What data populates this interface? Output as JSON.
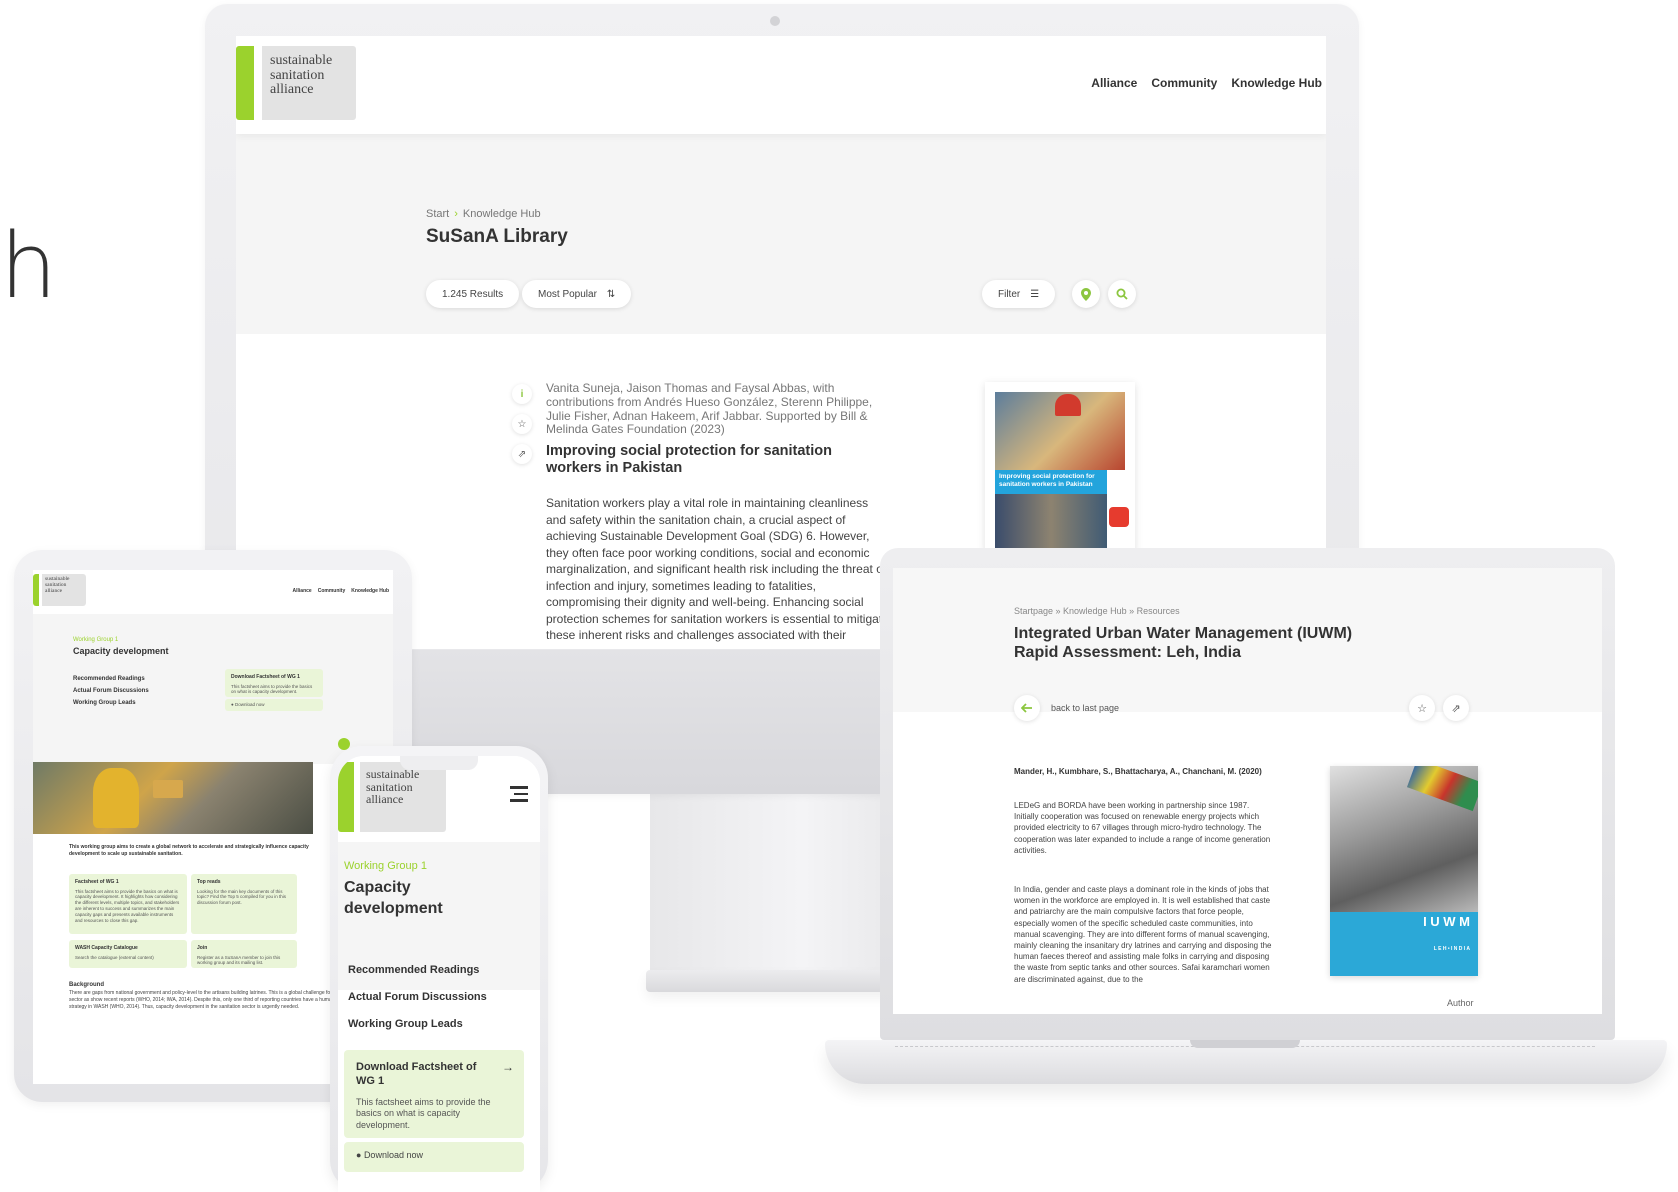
{
  "edge_letter": "h",
  "brand": {
    "logo_lines": [
      "sustainable",
      "sanitation",
      "alliance"
    ],
    "accent": "#9bd22d",
    "light_green": "#eaf5d8"
  },
  "nav": {
    "alliance": "Alliance",
    "community": "Community",
    "knowledge_hub": "Knowledge Hub"
  },
  "monitor": {
    "breadcrumb": [
      "Start",
      "Knowledge Hub"
    ],
    "title": "SuSanA Library",
    "results": "1.245 Results",
    "sort": "Most Popular",
    "filter": "Filter",
    "item": {
      "authors": "Vanita Suneja, Jaison Thomas and Faysal Abbas, with contributions from Andrés Hueso González, Sterenn Philippe, Julie Fisher, Adnan Hakeem, Arif Jabbar. Supported by Bill & Melinda Gates Foundation (2023)",
      "title": "Improving social protection for sanitation workers in Pakistan",
      "abstract": "Sanitation workers play a vital role in maintaining cleanliness and safety within the sanitation chain, a crucial aspect of achieving Sustainable Development Goal (SDG) 6. However, they often face poor working conditions, social and economic marginalization, and significant health risk including the threat of infection and injury, sometimes leading to fatalities, compromising their dignity and well-being. Enhancing social protection schemes for sanitation workers is essential to mitigate these inherent risks and challenges associated with their profession. WaterAid",
      "cover_caption": "Improving social protection for sanitation workers in Pakistan"
    }
  },
  "tablet": {
    "eyebrow": "Working Group 1",
    "title": "Capacity development",
    "links": [
      "Recommended Readings",
      "Actual Forum Discussions",
      "Working Group Leads"
    ],
    "download_card": {
      "title": "Download Factsheet of WG 1",
      "text": "This factsheet aims to provide the basics on what is capacity development.",
      "button": "Download now"
    },
    "intro": "This working group aims to create a global network to accelerate and strategically influence capacity development to scale up sustainable sanitation.",
    "cards": [
      {
        "title": "Factsheet of WG 1",
        "text": "This factsheet aims to provide the basics on what is capacity development. It highlights how considering the different levels, multiple topics, and stakeholders are inherent to success and summarizes the main capacity gaps and presents available instruments and resources to close this gap."
      },
      {
        "title": "Top reads",
        "text": "Looking for the main key documents of this topic? Find the Top 5 compiled for you in this discussion forum post."
      },
      {
        "title": "WASH Capacity Catalogue",
        "text": "Search the catalogue (external content)"
      },
      {
        "title": "Join",
        "text": "Register as a SuSanA member to join this working group and its mailing list."
      }
    ],
    "background_title": "Background",
    "background_text": "There are gaps from national government and policy-level to the artisans building latrines. This is a global challenge for the WASH sector as show recent reports (WHO, 2014; IWA, 2014). Despite this, only one third of reporting countries have a human resources strategy in WASH (WHO, 2014). Thus, capacity development in the sanitation sector is urgently needed."
  },
  "phone": {
    "eyebrow": "Working Group 1",
    "title": "Capacity development",
    "links": [
      "Recommended Readings",
      "Actual Forum Discussions",
      "Working Group Leads"
    ],
    "download_title": "Download Factsheet of WG 1",
    "download_text": "This factsheet aims to provide the basics on what is capacity development.",
    "download_button": "Download now"
  },
  "laptop": {
    "breadcrumb": "Startpage » Knowledge Hub » Resources",
    "title": "Integrated Urban Water Management (IUWM) Rapid Assessment: Leh, India",
    "back": "back to last page",
    "authors": "Mander, H., Kumbhare, S., Bhattacharya, A., Chanchani, M. (2020)",
    "para1": "LEDeG and BORDA have been working in partnership since 1987. Initially cooperation was focused on renewable energy projects which provided electricity to 67 villages through micro-hydro technology. The cooperation was later expanded to include a range of income generation activities.",
    "para2": "In India, gender and caste plays a dominant role in the kinds of jobs that women in the workforce are employed in. It is well established that caste and patriarchy are the main compulsive factors that force people, especially women of the specific scheduled caste communities, into manual scavenging. They are into different forms of manual scavenging, mainly cleaning the insanitary dry latrines and carrying and disposing the human faeces thereof and assisting male folks in carrying and disposing the waste from septic tanks and other sources. Safai karamchari women are discriminated against, due to the",
    "cover_title": "I U W M",
    "cover_sub": "L E H  •  I N D I A",
    "author_label": "Author"
  }
}
